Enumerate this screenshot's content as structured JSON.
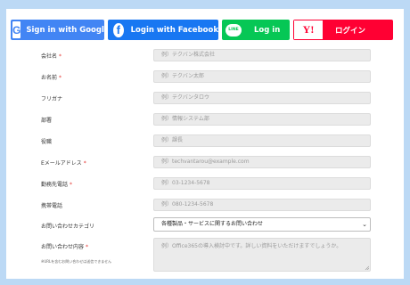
{
  "social": {
    "google": {
      "icon": "google-g-icon",
      "icon_text": "G",
      "label": "Sign in with Google",
      "color": "#4285f4"
    },
    "facebook": {
      "icon": "facebook-icon",
      "icon_text": "f",
      "label": "Login with Facebook",
      "color": "#1877f2"
    },
    "line": {
      "icon": "line-icon",
      "icon_text": "LINE",
      "label": "Log in",
      "color": "#06c755"
    },
    "yahoo": {
      "icon": "yahoo-japan-icon",
      "icon_text": "Y!",
      "label": "ログイン",
      "color": "#ff0033"
    }
  },
  "form": {
    "company": {
      "label": "会社名",
      "required": "*",
      "placeholder": "例）テクバン株式会社"
    },
    "name": {
      "label": "お名前",
      "required": "*",
      "placeholder": "例）テクバン太郎"
    },
    "furigana": {
      "label": "フリガナ",
      "placeholder": "例）テクバンタロウ"
    },
    "department": {
      "label": "部署",
      "placeholder": "例）情報システム部"
    },
    "position": {
      "label": "役職",
      "placeholder": "例）課長"
    },
    "email": {
      "label": "Eメールアドレス",
      "required": "*",
      "placeholder": "例）techvantarou@example.com"
    },
    "office_phone": {
      "label": "勤務先電話",
      "required": "*",
      "placeholder": "例）03-1234-5678"
    },
    "mobile_phone": {
      "label": "携帯電話",
      "placeholder": "例）080-1234-5678"
    },
    "category": {
      "label": "お問い合わせカテゴリ",
      "selected": "各種製品・サービスに関するお問い合わせ"
    },
    "inquiry": {
      "label": "お問い合わせ内容",
      "required": "*",
      "note": "※URLを含むお問い合わせは送信できません",
      "placeholder": "例）Office365の導入検討中です。詳しい資料をいただけますでしょうか。"
    }
  },
  "colors": {
    "background": "#bcd9f5",
    "required": "#e53935",
    "input_bg": "#ebebeb"
  }
}
